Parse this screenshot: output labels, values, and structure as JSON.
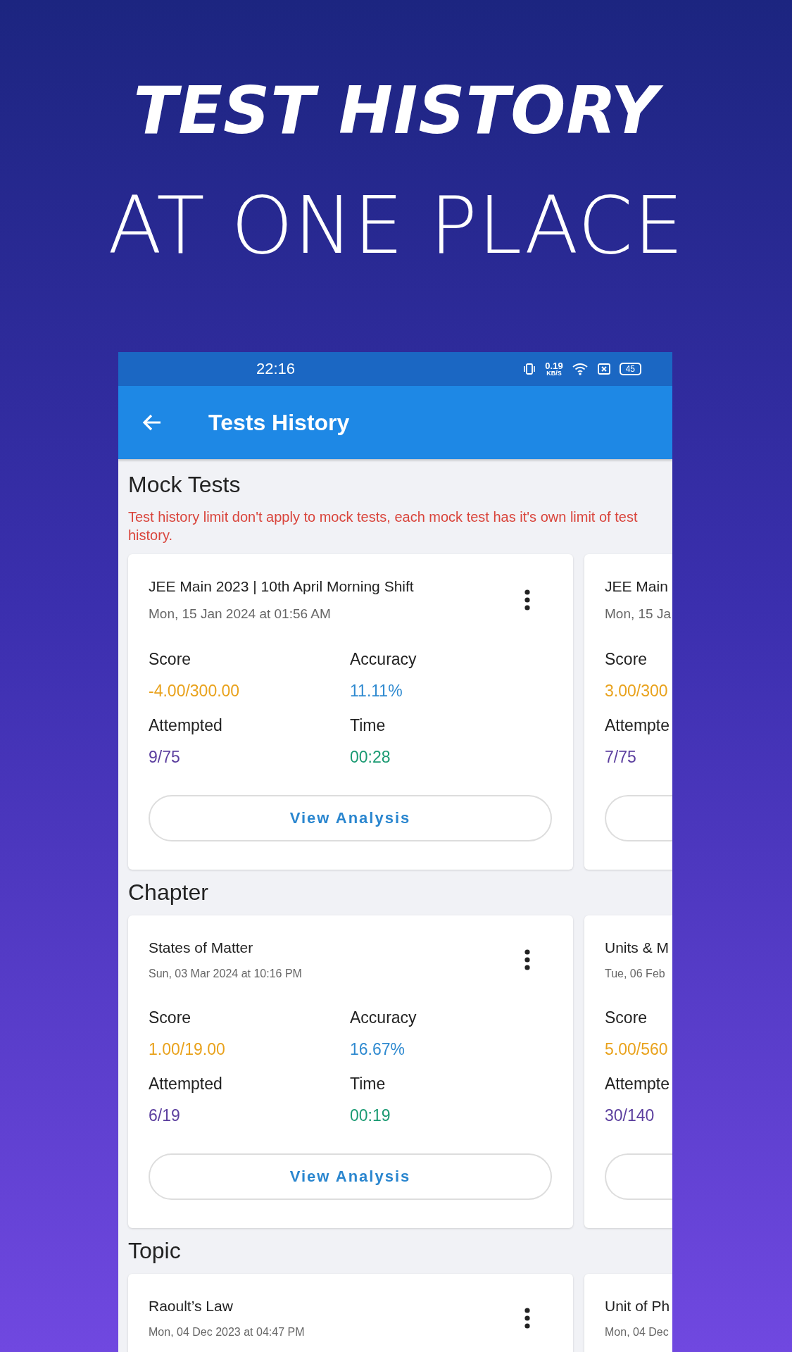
{
  "headline": {
    "title": "TEST HISTORY",
    "subtitle": "AT ONE PLACE"
  },
  "status_bar": {
    "time": "22:16",
    "net_speed": "0.19",
    "net_unit": "KB/S",
    "battery": "45"
  },
  "app_bar": {
    "title": "Tests History"
  },
  "sections": [
    {
      "title": "Mock Tests",
      "note": "Test history limit don't apply to mock tests, each mock test has it's own limit of test history.",
      "small_dates": false,
      "cards": [
        {
          "kind": "full",
          "name": "JEE Main 2023 | 10th April Morning Shift",
          "date": "Mon, 15 Jan 2024 at 01:56 AM",
          "columns": [
            [
              {
                "kind": "score",
                "label": "Score",
                "value": "-4.00/300.00"
              },
              {
                "kind": "attempted",
                "label": "Attempted",
                "value": "9/75"
              }
            ],
            [
              {
                "kind": "accuracy",
                "label": "Accuracy",
                "value": "11.11%"
              },
              {
                "kind": "time",
                "label": "Time",
                "value": "00:28"
              }
            ]
          ],
          "button": "View Analysis"
        },
        {
          "kind": "partial",
          "name": "JEE Main",
          "date": "Mon, 15 Ja",
          "columns": [
            [
              {
                "kind": "score",
                "label": "Score",
                "value": "3.00/300"
              },
              {
                "kind": "attempted",
                "label": "Attempte",
                "value": "7/75"
              }
            ]
          ]
        }
      ]
    },
    {
      "title": "Chapter",
      "small_dates": true,
      "cards": [
        {
          "kind": "full",
          "name": "States of Matter",
          "date": "Sun, 03 Mar 2024 at 10:16 PM",
          "columns": [
            [
              {
                "kind": "score",
                "label": "Score",
                "value": "1.00/19.00"
              },
              {
                "kind": "attempted",
                "label": "Attempted",
                "value": "6/19"
              }
            ],
            [
              {
                "kind": "accuracy",
                "label": "Accuracy",
                "value": "16.67%"
              },
              {
                "kind": "time",
                "label": "Time",
                "value": "00:19"
              }
            ]
          ],
          "button": "View Analysis"
        },
        {
          "kind": "partial",
          "name": "Units & M",
          "date": "Tue, 06 Feb",
          "columns": [
            [
              {
                "kind": "score",
                "label": "Score",
                "value": "5.00/560"
              },
              {
                "kind": "attempted",
                "label": "Attempte",
                "value": "30/140"
              }
            ]
          ]
        }
      ]
    },
    {
      "title": "Topic",
      "small_dates": true,
      "cards": [
        {
          "kind": "full",
          "name": "Raoult’s Law",
          "date": "Mon, 04 Dec 2023 at 04:47 PM"
        },
        {
          "kind": "partial",
          "name": "Unit of Ph",
          "date": "Mon, 04 Dec"
        }
      ]
    }
  ]
}
